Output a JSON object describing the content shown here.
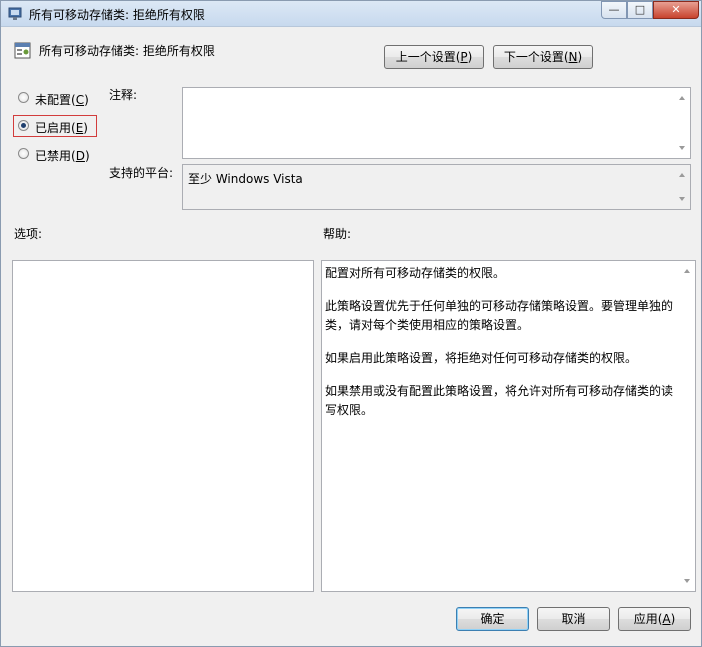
{
  "window": {
    "title": "所有可移动存储类: 拒绝所有权限",
    "controls": {
      "minimize": "—",
      "maximize": "□",
      "close": "✕"
    }
  },
  "header": {
    "policy_title": "所有可移动存储类: 拒绝所有权限",
    "prev_button": {
      "text": "上一个设置(",
      "key": "P",
      "suffix": ")"
    },
    "next_button": {
      "text": "下一个设置(",
      "key": "N",
      "suffix": ")"
    }
  },
  "state": {
    "options": [
      {
        "text": "未配置(",
        "key": "C",
        "suffix": ")",
        "selected": false
      },
      {
        "text": "已启用(",
        "key": "E",
        "suffix": ")",
        "selected": true
      },
      {
        "text": "已禁用(",
        "key": "D",
        "suffix": ")",
        "selected": false
      }
    ]
  },
  "comment": {
    "label": "注释:",
    "value": ""
  },
  "platform": {
    "label": "支持的平台:",
    "value": "至少 Windows Vista"
  },
  "options_pane": {
    "label": "选项:"
  },
  "help_pane": {
    "label": "帮助:",
    "paragraphs": [
      "配置对所有可移动存储类的权限。",
      "此策略设置优先于任何单独的可移动存储策略设置。要管理单独的类，请对每个类使用相应的策略设置。",
      "如果启用此策略设置，将拒绝对任何可移动存储类的权限。",
      "如果禁用或没有配置此策略设置，将允许对所有可移动存储类的读写权限。"
    ]
  },
  "footer": {
    "ok_button": "确定",
    "cancel_button": "取消",
    "apply_button": {
      "text": "应用(",
      "key": "A",
      "suffix": ")"
    }
  },
  "colors": {
    "focus_highlight": "#d23c3c",
    "default_button_border": "#3c7fb1"
  }
}
